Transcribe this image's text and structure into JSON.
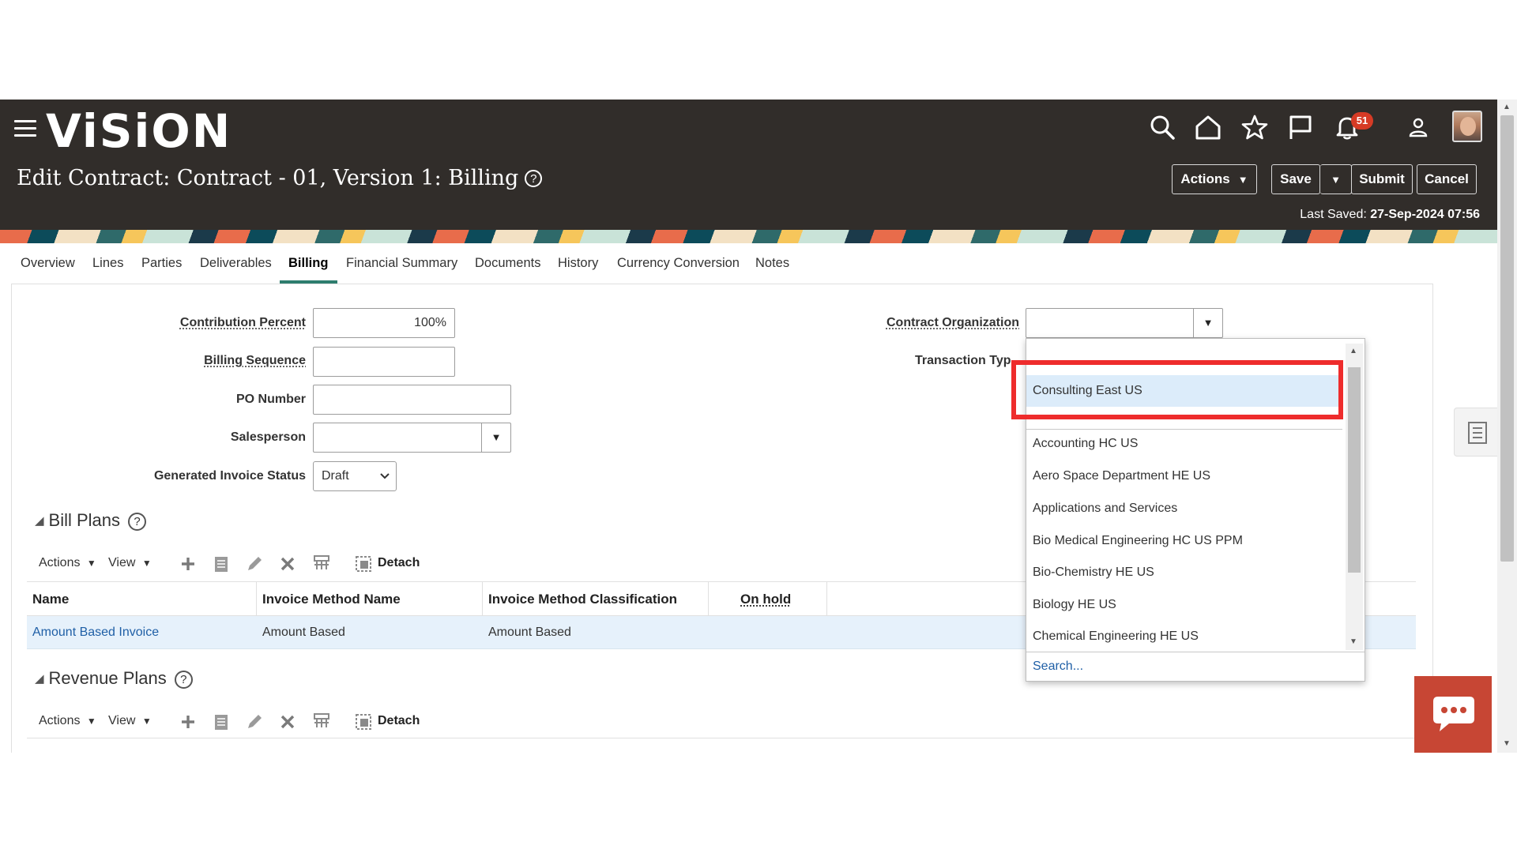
{
  "header": {
    "logo": "ViSiON",
    "page_title": "Edit Contract: Contract - 01, Version 1: Billing",
    "help": "?",
    "notification_count": "51",
    "buttons": {
      "actions": "Actions",
      "save": "Save",
      "submit": "Submit",
      "cancel": "Cancel"
    },
    "last_saved_label": "Last Saved:",
    "last_saved_value": "27-Sep-2024 07:56"
  },
  "tabs": [
    "Overview",
    "Lines",
    "Parties",
    "Deliverables",
    "Billing",
    "Financial Summary",
    "Documents",
    "History",
    "Currency Conversion",
    "Notes"
  ],
  "active_tab": "Billing",
  "form": {
    "contribution_percent_label": "Contribution Percent",
    "contribution_percent_value": "100%",
    "billing_sequence_label": "Billing Sequence",
    "billing_sequence_value": "",
    "po_number_label": "PO Number",
    "po_number_value": "",
    "salesperson_label": "Salesperson",
    "salesperson_value": "",
    "generated_invoice_status_label": "Generated Invoice Status",
    "generated_invoice_status_value": "Draft",
    "contract_organization_label": "Contract Organization",
    "contract_organization_value": "",
    "transaction_type_label": "Transaction Typ"
  },
  "bill_plans": {
    "title": "Bill Plans",
    "toolbar": {
      "actions": "Actions",
      "view": "View",
      "detach": "Detach"
    },
    "columns": [
      "Name",
      "Invoice Method Name",
      "Invoice Method Classification",
      "On hold"
    ],
    "rows": [
      {
        "name": "Amount Based Invoice",
        "invoice_method_name": "Amount Based",
        "invoice_method_classification": "Amount Based",
        "on_hold": ""
      }
    ]
  },
  "revenue_plans": {
    "title": "Revenue Plans",
    "toolbar": {
      "actions": "Actions",
      "view": "View",
      "detach": "Detach"
    }
  },
  "dropdown": {
    "highlighted": "Consulting East US",
    "items": [
      "Accounting HC US",
      "Aero Space Department HE US",
      "Applications and Services",
      "Bio Medical Engineering HC US PPM",
      "Bio-Chemistry HE US",
      "Biology HE US",
      "Chemical Engineering HE US"
    ],
    "search_label": "Search..."
  },
  "colors": {
    "header_bg": "#312d2a",
    "accent": "#2e7d6e",
    "link": "#1f5fa6",
    "highlight_box": "#ee2c2c",
    "chat": "#c74634"
  }
}
